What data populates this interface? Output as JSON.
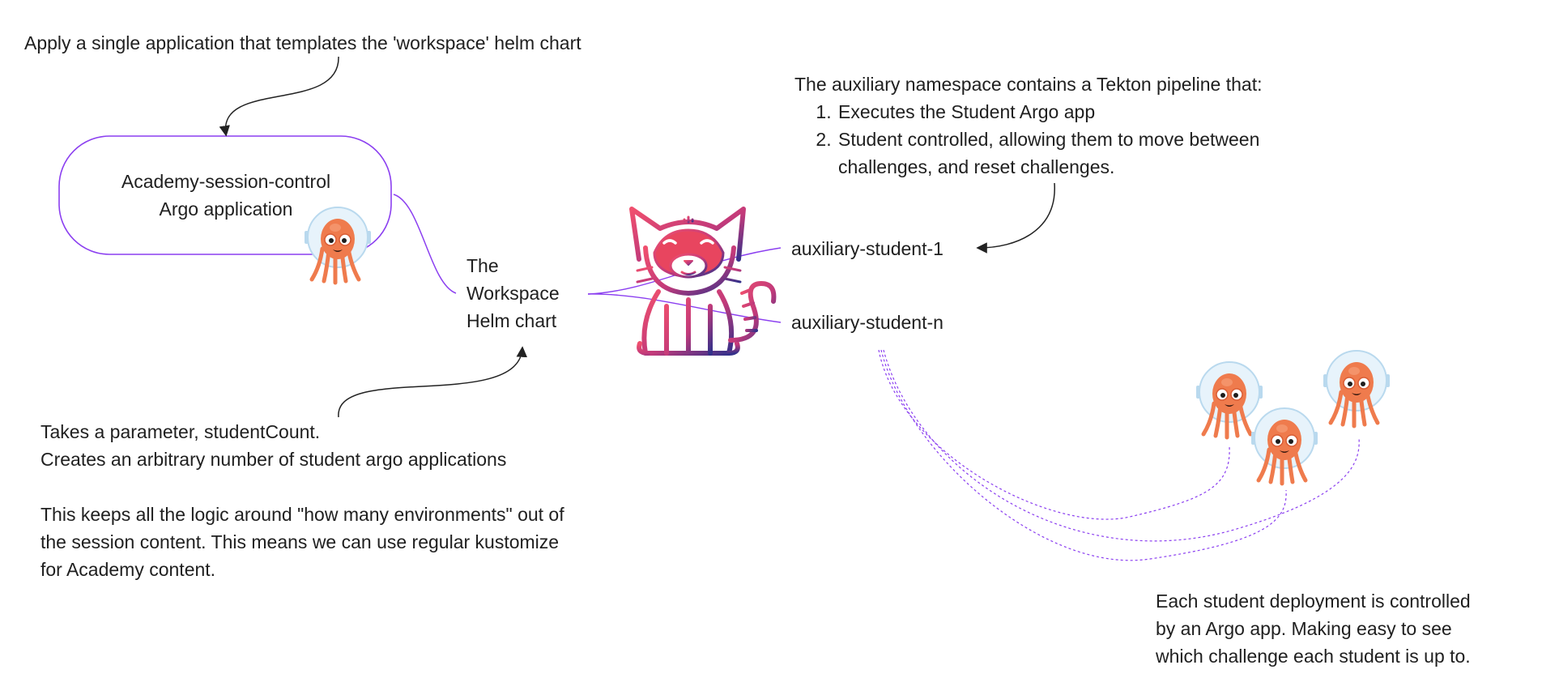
{
  "annotations": {
    "apply_note": "Apply a single application that templates the 'workspace' helm chart",
    "session_control": {
      "line1": "Academy-session-control",
      "line2": "Argo application"
    },
    "workspace_chart": {
      "line1": "The",
      "line2": "Workspace",
      "line3": "Helm chart"
    },
    "params_note": {
      "line1": "Takes a parameter, studentCount.",
      "line2": "Creates an arbitrary number of student argo applications",
      "line3": "This keeps all the logic around \"how many environments\" out of",
      "line4": "the session content. This means we can use regular kustomize",
      "line5": "for Academy content."
    },
    "namespace_note": {
      "intro": "The auxiliary namespace contains a Tekton pipeline that:",
      "steps": [
        "Executes the Student Argo app",
        "Student controlled, allowing them to move between challenges, and reset challenges."
      ]
    },
    "students": {
      "first": "auxiliary-student-1",
      "last": "auxiliary-student-n"
    },
    "deployment_note": {
      "line1": "Each student deployment is controlled",
      "line2": "by an Argo app. Making easy to see",
      "line3": "which challenge each student is up to."
    }
  },
  "colors": {
    "connector_purple": "#8b3ff0",
    "argo_orange": "#ef7b4d",
    "tekton_pink": "#e3436b",
    "tekton_navy": "#3b2f8a",
    "arrow": "#222222"
  },
  "icons": {
    "argo": "argo-octopus-icon",
    "tekton": "tekton-cat-icon"
  }
}
